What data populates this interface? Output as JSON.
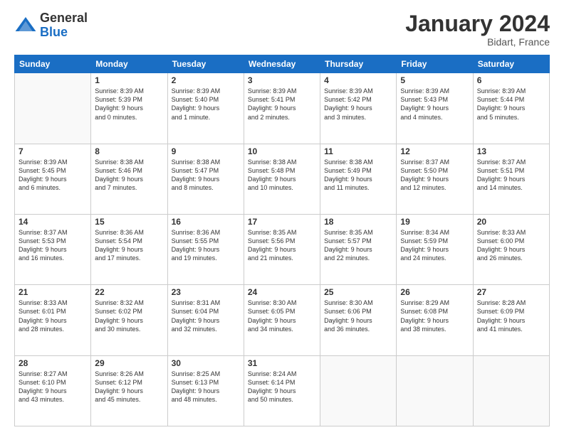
{
  "logo": {
    "general": "General",
    "blue": "Blue"
  },
  "header": {
    "month": "January 2024",
    "location": "Bidart, France"
  },
  "days_of_week": [
    "Sunday",
    "Monday",
    "Tuesday",
    "Wednesday",
    "Thursday",
    "Friday",
    "Saturday"
  ],
  "weeks": [
    [
      {
        "day": "",
        "info": ""
      },
      {
        "day": "1",
        "info": "Sunrise: 8:39 AM\nSunset: 5:39 PM\nDaylight: 9 hours\nand 0 minutes."
      },
      {
        "day": "2",
        "info": "Sunrise: 8:39 AM\nSunset: 5:40 PM\nDaylight: 9 hours\nand 1 minute."
      },
      {
        "day": "3",
        "info": "Sunrise: 8:39 AM\nSunset: 5:41 PM\nDaylight: 9 hours\nand 2 minutes."
      },
      {
        "day": "4",
        "info": "Sunrise: 8:39 AM\nSunset: 5:42 PM\nDaylight: 9 hours\nand 3 minutes."
      },
      {
        "day": "5",
        "info": "Sunrise: 8:39 AM\nSunset: 5:43 PM\nDaylight: 9 hours\nand 4 minutes."
      },
      {
        "day": "6",
        "info": "Sunrise: 8:39 AM\nSunset: 5:44 PM\nDaylight: 9 hours\nand 5 minutes."
      }
    ],
    [
      {
        "day": "7",
        "info": "Sunrise: 8:39 AM\nSunset: 5:45 PM\nDaylight: 9 hours\nand 6 minutes."
      },
      {
        "day": "8",
        "info": "Sunrise: 8:38 AM\nSunset: 5:46 PM\nDaylight: 9 hours\nand 7 minutes."
      },
      {
        "day": "9",
        "info": "Sunrise: 8:38 AM\nSunset: 5:47 PM\nDaylight: 9 hours\nand 8 minutes."
      },
      {
        "day": "10",
        "info": "Sunrise: 8:38 AM\nSunset: 5:48 PM\nDaylight: 9 hours\nand 10 minutes."
      },
      {
        "day": "11",
        "info": "Sunrise: 8:38 AM\nSunset: 5:49 PM\nDaylight: 9 hours\nand 11 minutes."
      },
      {
        "day": "12",
        "info": "Sunrise: 8:37 AM\nSunset: 5:50 PM\nDaylight: 9 hours\nand 12 minutes."
      },
      {
        "day": "13",
        "info": "Sunrise: 8:37 AM\nSunset: 5:51 PM\nDaylight: 9 hours\nand 14 minutes."
      }
    ],
    [
      {
        "day": "14",
        "info": "Sunrise: 8:37 AM\nSunset: 5:53 PM\nDaylight: 9 hours\nand 16 minutes."
      },
      {
        "day": "15",
        "info": "Sunrise: 8:36 AM\nSunset: 5:54 PM\nDaylight: 9 hours\nand 17 minutes."
      },
      {
        "day": "16",
        "info": "Sunrise: 8:36 AM\nSunset: 5:55 PM\nDaylight: 9 hours\nand 19 minutes."
      },
      {
        "day": "17",
        "info": "Sunrise: 8:35 AM\nSunset: 5:56 PM\nDaylight: 9 hours\nand 21 minutes."
      },
      {
        "day": "18",
        "info": "Sunrise: 8:35 AM\nSunset: 5:57 PM\nDaylight: 9 hours\nand 22 minutes."
      },
      {
        "day": "19",
        "info": "Sunrise: 8:34 AM\nSunset: 5:59 PM\nDaylight: 9 hours\nand 24 minutes."
      },
      {
        "day": "20",
        "info": "Sunrise: 8:33 AM\nSunset: 6:00 PM\nDaylight: 9 hours\nand 26 minutes."
      }
    ],
    [
      {
        "day": "21",
        "info": "Sunrise: 8:33 AM\nSunset: 6:01 PM\nDaylight: 9 hours\nand 28 minutes."
      },
      {
        "day": "22",
        "info": "Sunrise: 8:32 AM\nSunset: 6:02 PM\nDaylight: 9 hours\nand 30 minutes."
      },
      {
        "day": "23",
        "info": "Sunrise: 8:31 AM\nSunset: 6:04 PM\nDaylight: 9 hours\nand 32 minutes."
      },
      {
        "day": "24",
        "info": "Sunrise: 8:30 AM\nSunset: 6:05 PM\nDaylight: 9 hours\nand 34 minutes."
      },
      {
        "day": "25",
        "info": "Sunrise: 8:30 AM\nSunset: 6:06 PM\nDaylight: 9 hours\nand 36 minutes."
      },
      {
        "day": "26",
        "info": "Sunrise: 8:29 AM\nSunset: 6:08 PM\nDaylight: 9 hours\nand 38 minutes."
      },
      {
        "day": "27",
        "info": "Sunrise: 8:28 AM\nSunset: 6:09 PM\nDaylight: 9 hours\nand 41 minutes."
      }
    ],
    [
      {
        "day": "28",
        "info": "Sunrise: 8:27 AM\nSunset: 6:10 PM\nDaylight: 9 hours\nand 43 minutes."
      },
      {
        "day": "29",
        "info": "Sunrise: 8:26 AM\nSunset: 6:12 PM\nDaylight: 9 hours\nand 45 minutes."
      },
      {
        "day": "30",
        "info": "Sunrise: 8:25 AM\nSunset: 6:13 PM\nDaylight: 9 hours\nand 48 minutes."
      },
      {
        "day": "31",
        "info": "Sunrise: 8:24 AM\nSunset: 6:14 PM\nDaylight: 9 hours\nand 50 minutes."
      },
      {
        "day": "",
        "info": ""
      },
      {
        "day": "",
        "info": ""
      },
      {
        "day": "",
        "info": ""
      }
    ]
  ]
}
